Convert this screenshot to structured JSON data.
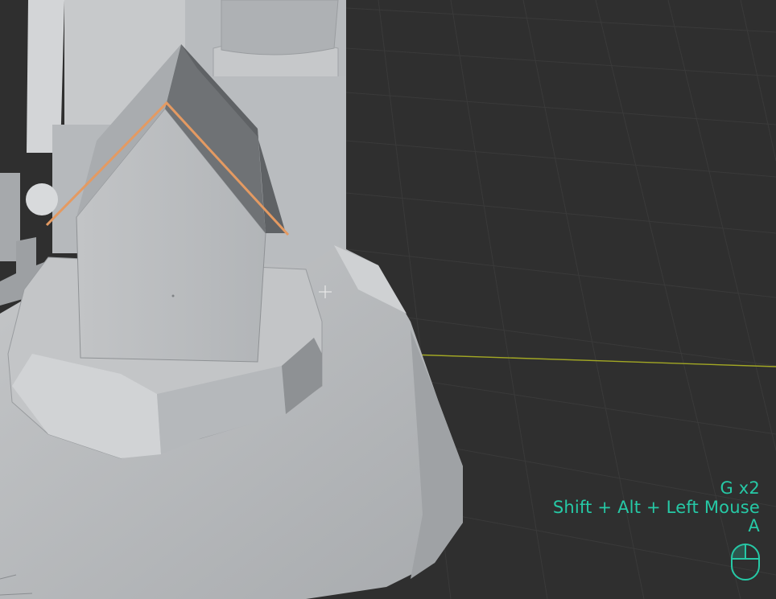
{
  "viewport": {
    "mode": "3D viewport - edit mode",
    "background_color": "#2f2f2f",
    "grid_color": "#3a3a3a",
    "x_axis_color": "#a3a824",
    "mesh_color": "#b9bcbf",
    "selected_edge_color": "#e49a62"
  },
  "keystrokes": {
    "lines": [
      "G x2",
      "Shift + Alt + Left Mouse",
      "A"
    ],
    "color": "#26c9a6",
    "icon": "mouse-left-click-icon"
  }
}
